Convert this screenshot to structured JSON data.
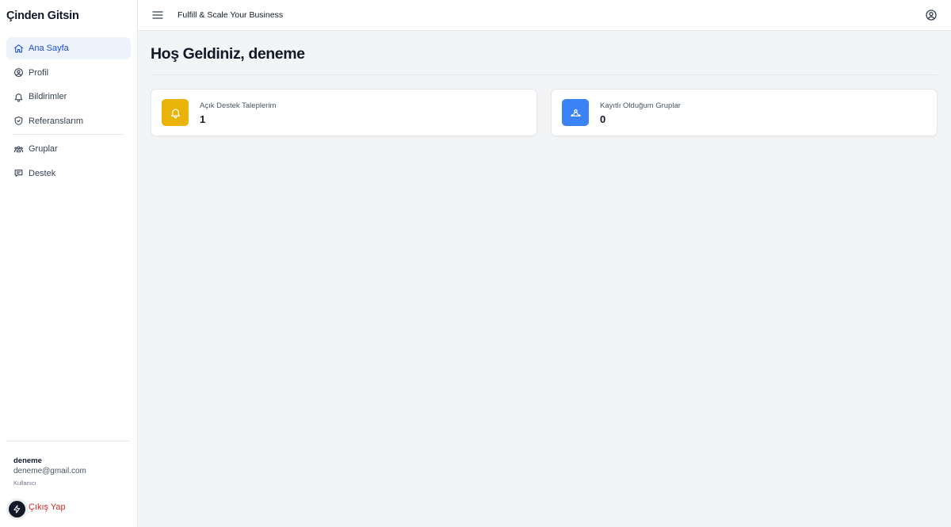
{
  "brand": {
    "name": "Çinden Gitsin"
  },
  "sidebar": {
    "items": [
      {
        "label": "Ana Sayfa",
        "icon": "home-icon",
        "active": true
      },
      {
        "label": "Profil",
        "icon": "user-circle-icon",
        "active": false
      },
      {
        "label": "Bildirimler",
        "icon": "bell-icon",
        "active": false
      },
      {
        "label": "Referanslarım",
        "icon": "shield-icon",
        "active": false
      },
      {
        "label": "Gruplar",
        "icon": "users-group-icon",
        "active": false
      },
      {
        "label": "Destek",
        "icon": "message-icon",
        "active": false
      }
    ]
  },
  "user": {
    "name": "deneme",
    "email": "deneme@gmail.com",
    "role": "Kullanıcı",
    "logout_label": "Çıkış Yap"
  },
  "topbar": {
    "title": "Fulfill & Scale Your Business",
    "menu_icon": "hamburger-menu-icon",
    "account_icon": "user-circle-icon"
  },
  "main": {
    "title": "Hoş Geldiniz, deneme",
    "cards": [
      {
        "label": "Açık Destek Taleplerim",
        "value": "1",
        "icon": "bell-icon",
        "color": "#eab308"
      },
      {
        "label": "Kayıtlı Olduğum Gruplar",
        "value": "0",
        "icon": "users-group-icon",
        "color": "#3b82f6"
      }
    ]
  },
  "colors": {
    "accent": "#1d4ed8",
    "active_bg": "#eef2fb",
    "logout": "#dc2626",
    "background": "#f3f4f6"
  }
}
